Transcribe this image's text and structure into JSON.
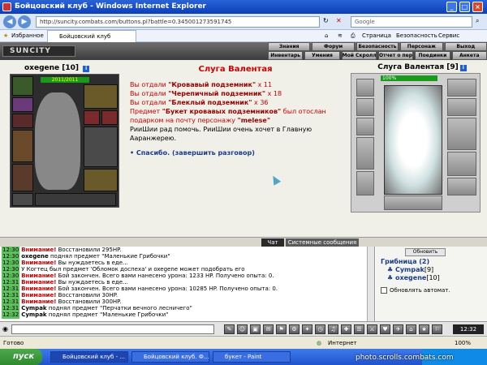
{
  "window": {
    "title": "Бойцовский клуб - Windows Internet Explorer",
    "url": "http://suncity.combats.com/buttons.pl?battle=0.345001273591745",
    "search_placeholder": "Google",
    "tab_label": "Бойцовский клуб",
    "favorites_label": "Избранное",
    "toolbar_items": [
      "Страница",
      "Безопасность",
      "Сервис"
    ]
  },
  "game_menu": {
    "logo": "SUNCITY",
    "top_row": [
      "Знания",
      "Форум",
      "Безопасность",
      "Персонаж",
      "Выход"
    ],
    "bottom_row": [
      "Инвентарь",
      "Умения",
      "Мой Скролл",
      "Отчет о переводах",
      "Поединки",
      "Анкета"
    ]
  },
  "player": {
    "name": "oxegene",
    "level": "[10]",
    "hp": "2011/2011"
  },
  "dialog": {
    "title": "Слуга Валентая",
    "lines": [
      {
        "prefix": "Вы отдали ",
        "item": "\"Кровавый подземник\"",
        "suffix": " x 11"
      },
      {
        "prefix": "Вы отдали ",
        "item": "\"Черепичный подземник\"",
        "suffix": " x 18"
      },
      {
        "prefix": "Вы отдали ",
        "item": "\"Блеклый подземник\"",
        "suffix": " x 36"
      }
    ],
    "gift_prefix": "Предмет ",
    "gift_item": "\"Букет кровавых подземников\"",
    "gift_middle": " был отослан подарком на почту персонажу ",
    "gift_recipient": "\"melese\"",
    "npc_text": "РииШии рад помочь. РииШии очень хочет в Главную Ааранжерею.",
    "action": "Спасибо. (завершить разговор)"
  },
  "npc": {
    "name": "Слуга Валентая",
    "level": "[9]",
    "hp": "100%"
  },
  "chat_tabs": [
    "Чат",
    "Системные сообщения"
  ],
  "chat_log": [
    {
      "time": "12:30",
      "warn": "Внимание!",
      "text": "Восстановили 295HP."
    },
    {
      "time": "12:30",
      "user": "oxegene",
      "text": "поднял предмет \"Маленькие Грибочки\""
    },
    {
      "time": "12:30",
      "warn": "Внимание!",
      "text": "Вы нуждаетесь в еде..."
    },
    {
      "time": "12:30",
      "text": "У Когтец был предмет 'Обломок доспеха' и oxegene может подобрать его"
    },
    {
      "time": "12:30",
      "warn": "Внимание!",
      "text": "Бой закончен. Всего вами нанесено урона: 1233 HP. Получено опыта: 0."
    },
    {
      "time": "12:31",
      "warn": "Внимание!",
      "text": "Вы нуждаетесь в еде..."
    },
    {
      "time": "12:31",
      "warn": "Внимание!",
      "text": "Бой закончен. Всего вами нанесено урона: 10285 HP. Получено опыта: 0."
    },
    {
      "time": "12:31",
      "warn": "Внимание!",
      "text": "Восстановили 30HP."
    },
    {
      "time": "12:31",
      "warn": "Внимание!",
      "text": "Восстановили 300HP."
    },
    {
      "time": "12:31",
      "user": "Cympak",
      "text": "поднял предмет \"Перчатки вечного лесничего\""
    },
    {
      "time": "12:32",
      "user": "Cympak",
      "text": "поднял предмет \"Маленькие Грибочки\""
    }
  ],
  "right_panel": {
    "refresh": "Обновить",
    "title": "Грибница (2)",
    "users": [
      {
        "name": "Cympak",
        "level": "[9]"
      },
      {
        "name": "oxegene",
        "level": "[10]"
      }
    ],
    "auto_refresh": "Обновлять автомат."
  },
  "clock": "12:32",
  "status": {
    "left": "Готово",
    "zone": "Интернет",
    "zoom": "100%"
  },
  "taskbar": {
    "start": "пуск",
    "tasks": [
      "Бойцовский клуб - ...",
      "Бойцовский клуб. Ф...",
      "букет - Paint"
    ]
  },
  "watermark": "photo.scrolls.combats.com"
}
